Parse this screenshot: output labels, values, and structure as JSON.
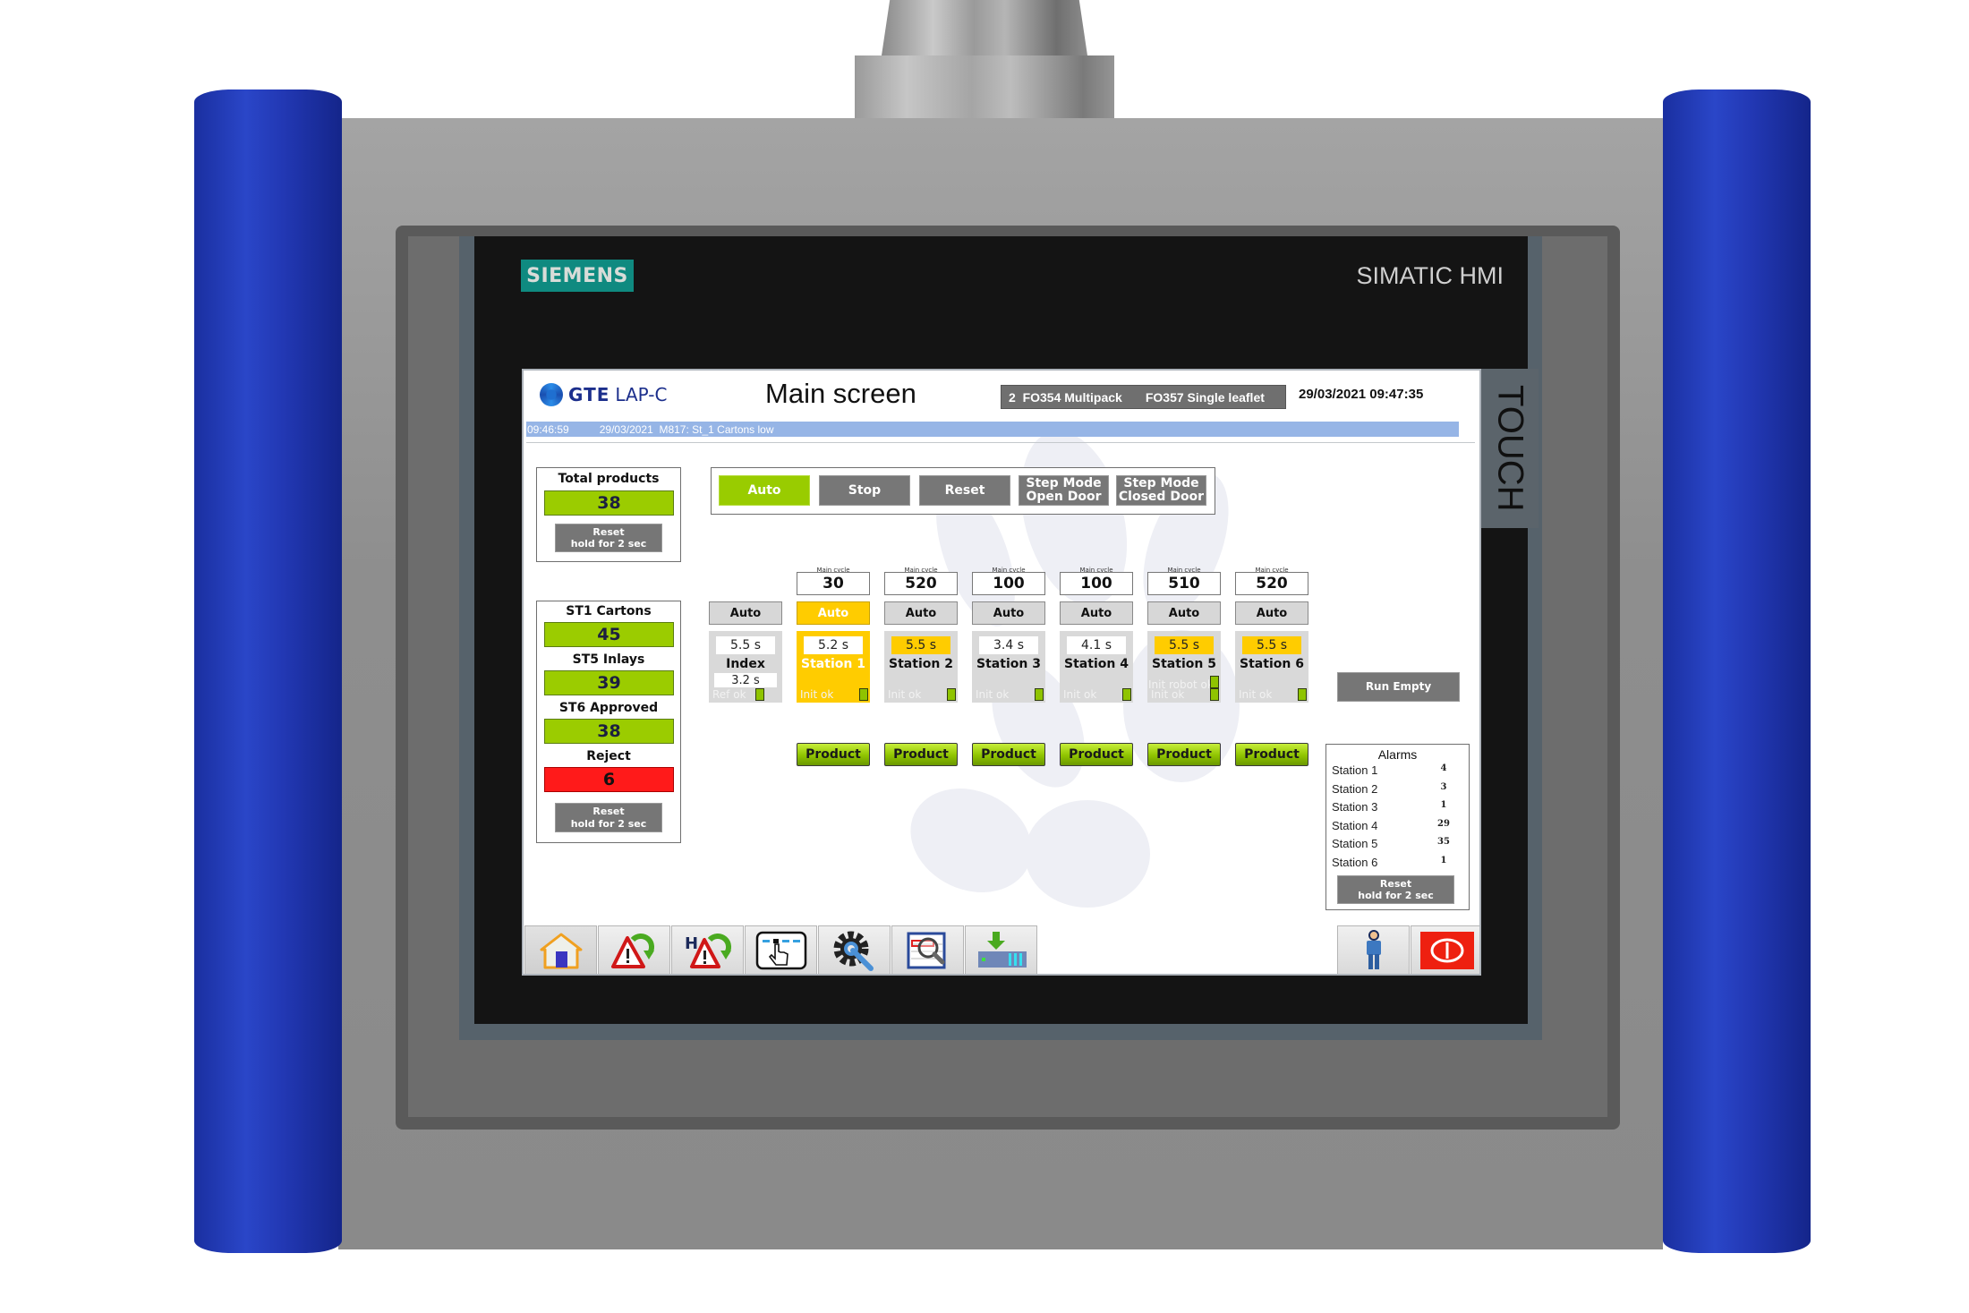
{
  "device": {
    "brand": "SIEMENS",
    "model": "SIMATIC HMI",
    "side_label": "TOUCH"
  },
  "header": {
    "logo_bold": "GTE",
    "logo_light": "LAP-C",
    "title": "Main screen",
    "recipe_number": "2",
    "recipe_primary": "FO354 Multipack",
    "recipe_secondary": "FO357 Single leaflet",
    "datetime": "29/03/2021 09:47:35"
  },
  "alarm_line": {
    "time": "09:46:59",
    "date": "29/03/2021",
    "message": "M817: St_1 Cartons low"
  },
  "total_products": {
    "label": "Total products",
    "value": "38",
    "reset_label": "Reset",
    "reset_hint": "hold for 2 sec"
  },
  "station_counters": {
    "items": [
      {
        "label": "ST1 Cartons",
        "value": "45",
        "status": "ok"
      },
      {
        "label": "ST5 Inlays",
        "value": "39",
        "status": "ok"
      },
      {
        "label": "ST6 Approved",
        "value": "38",
        "status": "ok"
      },
      {
        "label": "Reject",
        "value": "6",
        "status": "error"
      }
    ],
    "reset_label": "Reset",
    "reset_hint": "hold for 2 sec"
  },
  "controls": {
    "buttons": [
      {
        "label": "Auto",
        "active": true
      },
      {
        "label": "Stop",
        "active": false
      },
      {
        "label": "Reset",
        "active": false
      },
      {
        "label": "Step Mode Open Door",
        "line1": "Step Mode",
        "line2": "Open Door",
        "active": false
      },
      {
        "label": "Step Mode Closed Door",
        "line1": "Step Mode",
        "line2": "Closed Door",
        "active": false
      }
    ]
  },
  "main_cycle_label": "Main cycle",
  "index": {
    "mode": "Auto",
    "time": "5.5 s",
    "name": "Index",
    "sub_time": "3.2 s",
    "status": "Ref ok"
  },
  "stations": [
    {
      "name": "Station 1",
      "main_cycle": "30",
      "mode": "Auto",
      "time": "5.2 s",
      "status": "Init ok",
      "highlight": true,
      "time_warning": false,
      "product_label": "Product"
    },
    {
      "name": "Station 2",
      "main_cycle": "520",
      "mode": "Auto",
      "time": "5.5 s",
      "status": "Init ok",
      "highlight": false,
      "time_warning": true,
      "product_label": "Product"
    },
    {
      "name": "Station 3",
      "main_cycle": "100",
      "mode": "Auto",
      "time": "3.4 s",
      "status": "Init ok",
      "highlight": false,
      "time_warning": false,
      "product_label": "Product"
    },
    {
      "name": "Station 4",
      "main_cycle": "100",
      "mode": "Auto",
      "time": "4.1 s",
      "status": "Init ok",
      "highlight": false,
      "time_warning": false,
      "product_label": "Product"
    },
    {
      "name": "Station 5",
      "main_cycle": "510",
      "mode": "Auto",
      "time": "5.5 s",
      "status": "Init ok",
      "status_extra": "Init robot ok",
      "highlight": false,
      "time_warning": true,
      "product_label": "Product"
    },
    {
      "name": "Station 6",
      "main_cycle": "520",
      "mode": "Auto",
      "time": "5.5 s",
      "status": "Init ok",
      "highlight": false,
      "time_warning": true,
      "product_label": "Product"
    }
  ],
  "run_empty_label": "Run Empty",
  "alarms": {
    "title": "Alarms",
    "rows": [
      {
        "station": "Station 1",
        "count": "4"
      },
      {
        "station": "Station 2",
        "count": "3"
      },
      {
        "station": "Station 3",
        "count": "1"
      },
      {
        "station": "Station 4",
        "count": "29"
      },
      {
        "station": "Station 5",
        "count": "35"
      },
      {
        "station": "Station 6",
        "count": "1"
      }
    ],
    "reset_label": "Reset",
    "reset_hint": "hold for 2 sec"
  },
  "toolbar": {
    "left": [
      {
        "icon": "home-icon",
        "label": "Home"
      },
      {
        "icon": "alarm-warning-icon",
        "label": "Alarms"
      },
      {
        "icon": "alarm-history-icon",
        "label": "Alarm history",
        "prefix": "H"
      },
      {
        "icon": "touch-select-icon",
        "label": "Manual"
      },
      {
        "icon": "settings-wrench-icon",
        "label": "Settings"
      },
      {
        "icon": "data-search-icon",
        "label": "Data view"
      },
      {
        "icon": "download-machine-icon",
        "label": "Recipe load"
      }
    ],
    "right": [
      {
        "icon": "user-icon",
        "label": "User"
      },
      {
        "icon": "power-icon",
        "label": "Power"
      }
    ]
  },
  "colors": {
    "ok_green": "#99cc00",
    "active_yellow": "#ffcc00",
    "reject_red": "#ff1a1a",
    "button_gray": "#777777",
    "alarm_bar_blue": "#96b5e6",
    "siemens_teal": "#0f8a80",
    "roller_blue": "#2238b4"
  }
}
